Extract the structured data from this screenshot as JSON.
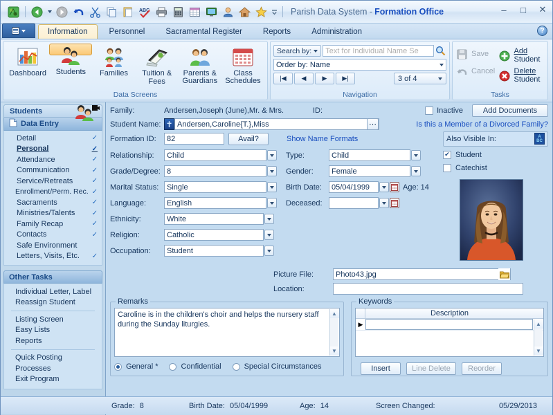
{
  "window": {
    "title_prefix": "Parish Data System -",
    "title_main": "Formation Office",
    "minimize": "–",
    "maximize": "□",
    "close": "✕"
  },
  "quick_access": [
    {
      "name": "app-logo-icon",
      "glyph": "▦"
    },
    {
      "name": "back-icon",
      "glyph": "◀"
    },
    {
      "name": "back-dropdown-icon",
      "glyph": "▾"
    },
    {
      "name": "forward-icon",
      "glyph": "▶"
    },
    {
      "name": "undo-icon",
      "glyph": "↺"
    },
    {
      "name": "cut-icon",
      "glyph": "✂"
    },
    {
      "name": "copy-icon",
      "glyph": "⧉"
    },
    {
      "name": "paste-icon",
      "glyph": "📋"
    },
    {
      "name": "spellcheck-icon",
      "glyph": "ABC"
    },
    {
      "name": "print-icon",
      "glyph": "🖨"
    },
    {
      "name": "calculator-icon",
      "glyph": "▥"
    },
    {
      "name": "table-icon",
      "glyph": "▦"
    },
    {
      "name": "screen-icon",
      "glyph": "🖥"
    },
    {
      "name": "contact-icon",
      "glyph": "👤"
    },
    {
      "name": "home-icon",
      "glyph": "⌂"
    },
    {
      "name": "favorites-icon",
      "glyph": "★"
    },
    {
      "name": "customize-icon",
      "glyph": "▾"
    }
  ],
  "tabs": {
    "app_menu_label": "",
    "items": [
      {
        "label": "Information",
        "active": true
      },
      {
        "label": "Personnel",
        "active": false
      },
      {
        "label": "Sacramental Register",
        "active": false
      },
      {
        "label": "Reports",
        "active": false
      },
      {
        "label": "Administration",
        "active": false
      }
    ],
    "help_label": "?"
  },
  "ribbon": {
    "data_screens": {
      "group_label": "Data Screens",
      "buttons": [
        {
          "label": "Dashboard",
          "icon": "chart-icon",
          "selected": false
        },
        {
          "label": "Students",
          "icon": "students-icon",
          "selected": true
        },
        {
          "label": "Families",
          "icon": "families-icon",
          "selected": false
        },
        {
          "label": "Tuition & Fees",
          "icon": "tuition-icon",
          "selected": false
        },
        {
          "label": "Parents & Guardians",
          "icon": "parents-icon",
          "selected": false
        },
        {
          "label": "Class Schedules",
          "icon": "calendar-icon",
          "selected": false
        }
      ]
    },
    "navigation": {
      "group_label": "Navigation",
      "search_by_label": "Search by:",
      "search_placeholder": "Text for Individual Name Se",
      "search_value": "",
      "order_by_label": "Order by: Name",
      "nav_first": "|◀",
      "nav_prev": "◀",
      "nav_next": "▶",
      "nav_last": "▶|",
      "record_counter": "3 of 4"
    },
    "tasks": {
      "group_label": "Tasks",
      "save_label": "Save",
      "cancel_label": "Cancel",
      "add_label_line1": "Add",
      "add_label_line2": "Student",
      "delete_label_line1": "Delete",
      "delete_label_line2": "Student"
    }
  },
  "sidebar": {
    "header": "Students",
    "data_entry_label": "Data Entry",
    "items": [
      {
        "label": "Detail",
        "check": true,
        "current": false
      },
      {
        "label": "Personal",
        "check": true,
        "current": true
      },
      {
        "label": "Attendance",
        "check": true,
        "current": false
      },
      {
        "label": "Communication",
        "check": true,
        "current": false
      },
      {
        "label": "Service/Retreats",
        "check": true,
        "current": false
      },
      {
        "label": "Enrollment/Perm. Rec.",
        "check": true,
        "current": false
      },
      {
        "label": "Sacraments",
        "check": true,
        "current": false
      },
      {
        "label": "Ministries/Talents",
        "check": true,
        "current": false
      },
      {
        "label": "Family Recap",
        "check": true,
        "current": false
      },
      {
        "label": "Contacts",
        "check": true,
        "current": false
      },
      {
        "label": "Safe Environment",
        "check": false,
        "current": false
      },
      {
        "label": "Letters, Visits, Etc.",
        "check": true,
        "current": false
      }
    ],
    "other_tasks_label": "Other Tasks",
    "other_groups": [
      [
        "Individual Letter, Label",
        "Reassign Student"
      ],
      [
        "Listing Screen",
        "Easy Lists",
        "Reports"
      ],
      [
        "Quick Posting",
        "Processes",
        "Exit Program"
      ]
    ]
  },
  "form": {
    "family_label": "Family:",
    "family_value": "Andersen,Joseph (June),Mr. & Mrs.",
    "id_label": "ID:",
    "id_value": "",
    "student_name_label": "Student Name:",
    "student_name_value": "Andersen,Caroline{T.},Miss",
    "cross_icon": "✝",
    "ellipsis_button": "⋯",
    "formation_id_label": "Formation ID:",
    "formation_id_value": "82",
    "avail_button": "Avail?",
    "show_name_formats": "Show Name Formats",
    "inactive_label": "Inactive",
    "inactive_checked": false,
    "add_documents_button": "Add Documents",
    "divorced_question": "Is this a Member of a Divorced Family?",
    "also_visible_in_label": "Also Visible In:",
    "also_visible_icon": "abc-icon",
    "left_fields": [
      {
        "label": "Relationship:",
        "value": "Child"
      },
      {
        "label": "Grade/Degree:",
        "value": "8"
      },
      {
        "label": "Marital Status:",
        "value": "Single"
      },
      {
        "label": "Language:",
        "value": "English"
      },
      {
        "label": "Ethnicity:",
        "value": "White"
      },
      {
        "label": "Religion:",
        "value": "Catholic"
      },
      {
        "label": "Occupation:",
        "value": "Student"
      }
    ],
    "right_fields": [
      {
        "label": "Type:",
        "value": "Child"
      },
      {
        "label": "Gender:",
        "value": "Female"
      }
    ],
    "birth_date_label": "Birth Date:",
    "birth_date_value": "05/04/1999",
    "age_label": "Age: 14",
    "deceased_label": "Deceased:",
    "deceased_value": "",
    "student_checkbox_label": "Student",
    "student_checked": true,
    "catechist_checkbox_label": "Catechist",
    "catechist_checked": false,
    "picture_file_label": "Picture File:",
    "picture_file_value": "Photo43.jpg",
    "location_label": "Location:",
    "location_value": "",
    "folder_icon": "📂"
  },
  "remarks": {
    "legend": "Remarks",
    "text": "Caroline is in the children's choir and helps the nursery staff during the Sunday liturgies.",
    "radios": [
      {
        "label": "General *",
        "selected": true
      },
      {
        "label": "Confidential",
        "selected": false
      },
      {
        "label": "Special Circumstances",
        "selected": false
      }
    ]
  },
  "keywords": {
    "legend": "Keywords",
    "column_header": "Description",
    "rows": [
      ""
    ],
    "insert_button": "Insert",
    "line_delete_button": "Line Delete",
    "reorder_button": "Reorder"
  },
  "status_bar": {
    "grade_label": "Grade:",
    "grade_value": "8",
    "birth_date_label": "Birth Date:",
    "birth_date_value": "05/04/1999",
    "age_label": "Age:",
    "age_value": "14",
    "screen_changed_label": "Screen Changed:",
    "screen_changed_value": "05/29/2013"
  },
  "colors": {
    "accent_blue": "#1a4fbf",
    "selected_orange": "#fbc976",
    "form_bg": "#c3dbf0",
    "sidebar_bg": "#cfe3f4",
    "text": "#16355c"
  }
}
